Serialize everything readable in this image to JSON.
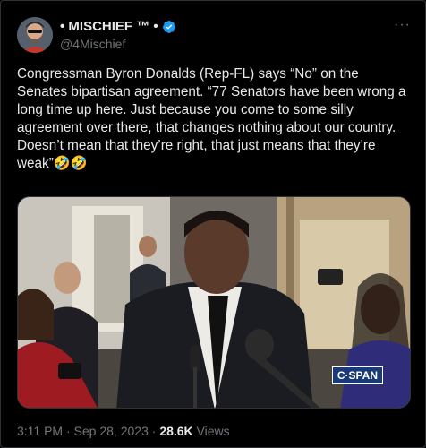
{
  "author": {
    "display_name": "• MISCHIEF ™ •",
    "handle": "@4Mischief",
    "verified_icon": "verified-badge-icon",
    "avatar_icon": "avatar"
  },
  "tweet": {
    "text": "Congressman Byron Donalds (Rep-FL) says “No” on the Senates bipartisan agreement. “77 Senators have been wrong a long time up here. Just because you come to some silly agreement over there, that changes nothing about our country. Doesn’t mean that they’re right, that just means that they’re weak”🤣🤣",
    "more_icon": "more-options-icon"
  },
  "media": {
    "watermark": "C·SPAN"
  },
  "meta": {
    "time": "3:11 PM",
    "separator1": " · ",
    "date": "Sep 28, 2023",
    "separator2": " · ",
    "views_count": "28.6K",
    "views_label": " Views"
  },
  "colors": {
    "background": "#000000",
    "text": "#e7e9ea",
    "secondary": "#71767b",
    "verified": "#1d9bf0",
    "border": "#2f3336"
  }
}
